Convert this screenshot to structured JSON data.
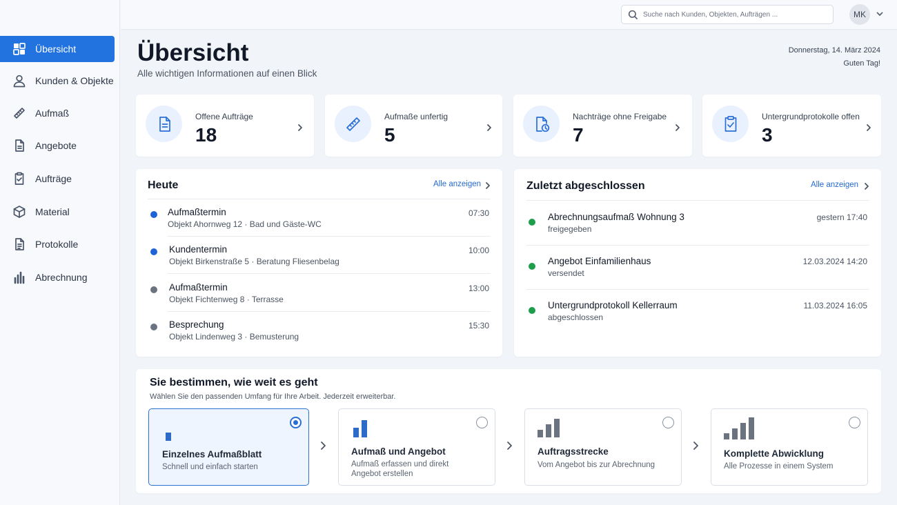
{
  "sidebar": {
    "items": [
      {
        "label": "Übersicht",
        "icon": "dashboard-icon",
        "active": true
      },
      {
        "label": "Kunden & Objekte",
        "icon": "user-icon"
      },
      {
        "label": "Aufmaß",
        "icon": "ruler-icon"
      },
      {
        "label": "Angebote",
        "icon": "document-icon"
      },
      {
        "label": "Aufträge",
        "icon": "clipboard-check-icon"
      },
      {
        "label": "Material",
        "icon": "box-icon"
      },
      {
        "label": "Protokolle",
        "icon": "file-text-icon"
      },
      {
        "label": "Abrechnung",
        "icon": "bar-chart-icon"
      }
    ]
  },
  "topbar": {
    "search_placeholder": "Suche nach Kunden, Objekten, Aufträgen ...",
    "avatar_initials": "MK"
  },
  "header": {
    "title": "Übersicht",
    "subtitle": "Alle wichtigen Informationen auf einen Blick",
    "date": "Donnerstag, 14. März 2024",
    "greeting": "Guten Tag!"
  },
  "stats": [
    {
      "label": "Offene Aufträge",
      "value": "18",
      "icon": "document-icon"
    },
    {
      "label": "Aufmaße unfertig",
      "value": "5",
      "icon": "ruler-icon"
    },
    {
      "label": "Nachträge ohne Freigabe",
      "value": "7",
      "icon": "document-clock-icon"
    },
    {
      "label": "Untergrundprotokolle offen",
      "value": "3",
      "icon": "clipboard-check-icon"
    }
  ],
  "today": {
    "title": "Heute",
    "link": "Alle anzeigen",
    "items": [
      {
        "title": "Aufmaßtermin",
        "sub": "Objekt Ahornweg 12 · Bad und Gäste-WC",
        "time": "07:30",
        "dot": "#1d63d6"
      },
      {
        "title": "Kundentermin",
        "sub": "Objekt Birkenstraße 5 · Beratung Fliesenbelag",
        "time": "10:00",
        "dot": "#1d63d6"
      },
      {
        "title": "Aufmaßtermin",
        "sub": "Objekt Fichtenweg 8 · Terrasse",
        "time": "13:00",
        "dot": "#6b7280"
      },
      {
        "title": "Besprechung",
        "sub": "Objekt Lindenweg 3 · Bemusterung",
        "time": "15:30",
        "dot": "#6b7280"
      }
    ]
  },
  "recent": {
    "title": "Zuletzt abgeschlossen",
    "link": "Alle anzeigen",
    "items": [
      {
        "title": "Abrechnungsaufmaß Wohnung 3",
        "sub": "freigegeben",
        "time": "gestern 17:40",
        "dot": "#1e9e4a"
      },
      {
        "title": "Angebot Einfamilienhaus",
        "sub": "versendet",
        "time": "12.03.2024 14:20",
        "dot": "#1e9e4a"
      },
      {
        "title": "Untergrundprotokoll Kellerraum",
        "sub": "abgeschlossen",
        "time": "11.03.2024 16:05",
        "dot": "#1e9e4a"
      }
    ]
  },
  "plans": {
    "title": "Sie bestimmen, wie weit es geht",
    "subtitle": "Wählen Sie den passenden Umfang für Ihre Arbeit. Jederzeit erweiterbar.",
    "options": [
      {
        "name": "Einzelnes Aufmaßblatt",
        "desc": "Schnell und einfach starten",
        "selected": true,
        "bars": 1
      },
      {
        "name": "Aufmaß und Angebot",
        "desc": "Aufmaß erfassen und direkt Angebot erstellen",
        "selected": false,
        "bars": 2
      },
      {
        "name": "Auftragsstrecke",
        "desc": "Vom Angebot bis zur Abrechnung",
        "selected": false,
        "bars": 3
      },
      {
        "name": "Komplette Abwicklung",
        "desc": "Alle Prozesse in einem System",
        "selected": false,
        "bars": 4
      }
    ]
  },
  "colors": {
    "accent": "#2273df",
    "plan_bar": "#2e6ac8",
    "plan_bar_inactive": "#6b7280"
  }
}
